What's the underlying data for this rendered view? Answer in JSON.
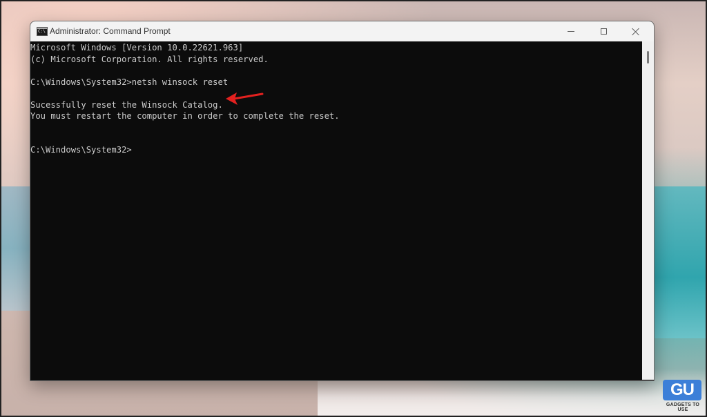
{
  "window": {
    "title": "Administrator: Command Prompt"
  },
  "terminal": {
    "lines": [
      "Microsoft Windows [Version 10.0.22621.963]",
      "(c) Microsoft Corporation. All rights reserved.",
      "C:\\Windows\\System32>netsh winsock reset",
      "Sucessfully reset the Winsock Catalog.",
      "You must restart the computer in order to complete the reset.",
      "C:\\Windows\\System32>"
    ]
  },
  "watermark": {
    "logo_text": "GU",
    "brand_text": "GADGETS TO USE"
  },
  "icons": {
    "app": "command-prompt-icon",
    "minimize": "minimize-icon",
    "maximize": "maximize-icon",
    "close": "close-icon",
    "annotation": "red-arrow-icon"
  },
  "colors": {
    "terminal_background": "#0c0c0c",
    "terminal_text": "#cccccc",
    "titlebar_background": "#f3f3f3",
    "annotation_arrow": "#e3211f",
    "watermark_blue": "#3c7fd8"
  }
}
